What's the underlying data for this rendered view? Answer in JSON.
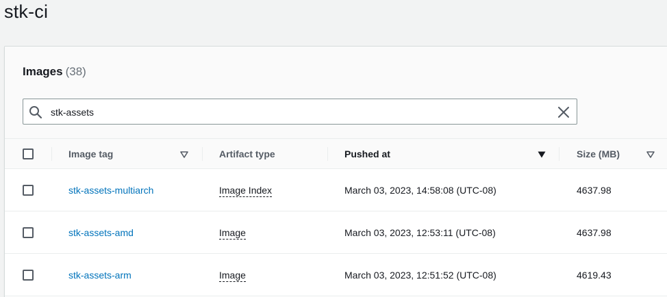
{
  "page": {
    "title": "stk-ci"
  },
  "panel": {
    "title": "Images",
    "count": "(38)"
  },
  "search": {
    "value": "stk-assets",
    "icon": "search-icon",
    "clear_icon": "close-icon"
  },
  "table": {
    "columns": [
      {
        "label": "Image tag",
        "sort": "sortable"
      },
      {
        "label": "Artifact type",
        "sort": "none"
      },
      {
        "label": "Pushed at",
        "sort": "descending"
      },
      {
        "label": "Size (MB)",
        "sort": "sortable"
      }
    ],
    "rows": [
      {
        "tag": "stk-assets-multiarch",
        "artifact_type": "Image Index",
        "pushed_at": "March 03, 2023, 14:58:08 (UTC-08)",
        "size": "4637.98"
      },
      {
        "tag": "stk-assets-amd",
        "artifact_type": "Image",
        "pushed_at": "March 03, 2023, 12:53:11 (UTC-08)",
        "size": "4637.98"
      },
      {
        "tag": "stk-assets-arm",
        "artifact_type": "Image",
        "pushed_at": "March 03, 2023, 12:51:52 (UTC-08)",
        "size": "4619.43"
      }
    ]
  },
  "colors": {
    "link": "#0073bb",
    "page_background": "#f2f3f3",
    "header_background": "#fafafa"
  }
}
